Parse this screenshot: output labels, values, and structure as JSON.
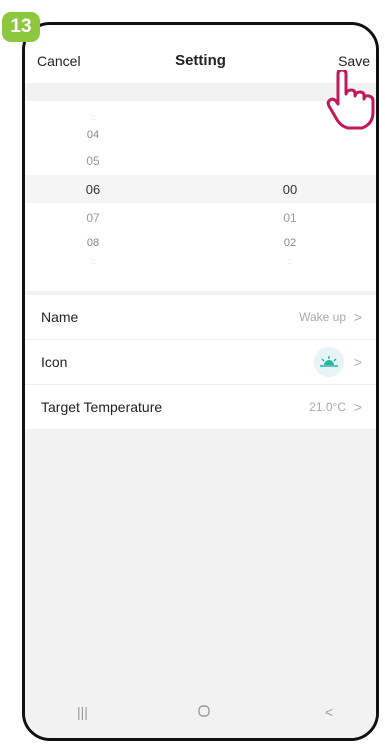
{
  "step": "13",
  "nav": {
    "cancel": "Cancel",
    "title": "Setting",
    "save": "Save"
  },
  "time_picker": {
    "hours": {
      "above": [
        "04",
        "05"
      ],
      "selected": "06",
      "below": [
        "07",
        "08"
      ]
    },
    "minutes": {
      "selected": "00",
      "below": [
        "01",
        "02"
      ]
    }
  },
  "settings": {
    "name": {
      "label": "Name",
      "value": "Wake up"
    },
    "icon": {
      "label": "Icon",
      "icon_name": "sunrise-icon",
      "color": "#2bb0a6"
    },
    "target_temperature": {
      "label": "Target Temperature",
      "value": "21.0°C"
    }
  },
  "colors": {
    "badge": "#8dc63f",
    "hand": "#c2185b"
  },
  "bottom_nav": {
    "recent": "recent-apps-icon",
    "home": "home-icon",
    "back": "back-icon"
  }
}
